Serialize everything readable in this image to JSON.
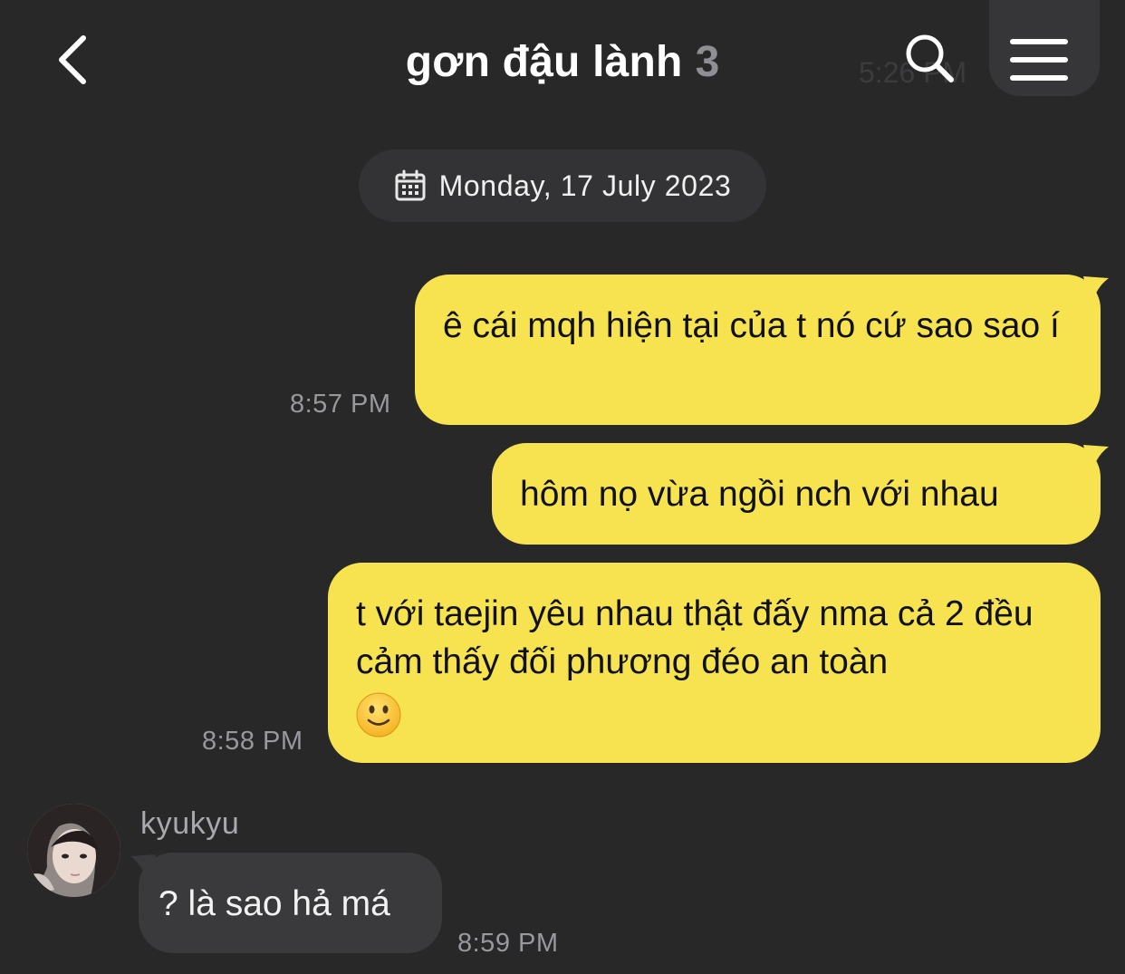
{
  "header": {
    "title": "gơn đậu lành",
    "member_count": "3",
    "ghost_time": "5:26 PM"
  },
  "date_separator": {
    "text": "Monday, 17 July 2023"
  },
  "messages": [
    {
      "sender": "me",
      "text": "ê cái mqh hiện tại của t nó cứ sao sao í",
      "time": "8:57 PM"
    },
    {
      "sender": "me",
      "text": "hôm nọ vừa ngồi nch với nhau",
      "time": ""
    },
    {
      "sender": "me",
      "text": "t với taejin yêu nhau thật đấy nma cả 2 đều cảm thấy đối phương đéo an toàn",
      "emoji": "slightly-smiling-face",
      "time": "8:58 PM"
    },
    {
      "sender": "kyukyu",
      "sender_name": "kyukyu",
      "text": "? là sao hả má",
      "time": "8:59 PM"
    }
  ],
  "icons": {
    "back": "chevron-left-icon",
    "search": "search-icon",
    "menu": "menu-icon",
    "calendar": "calendar-icon"
  },
  "colors": {
    "background": "#282829",
    "outgoing_bubble": "#f7e34f",
    "incoming_bubble": "#3a3a3c",
    "timestamp": "#98989d"
  }
}
